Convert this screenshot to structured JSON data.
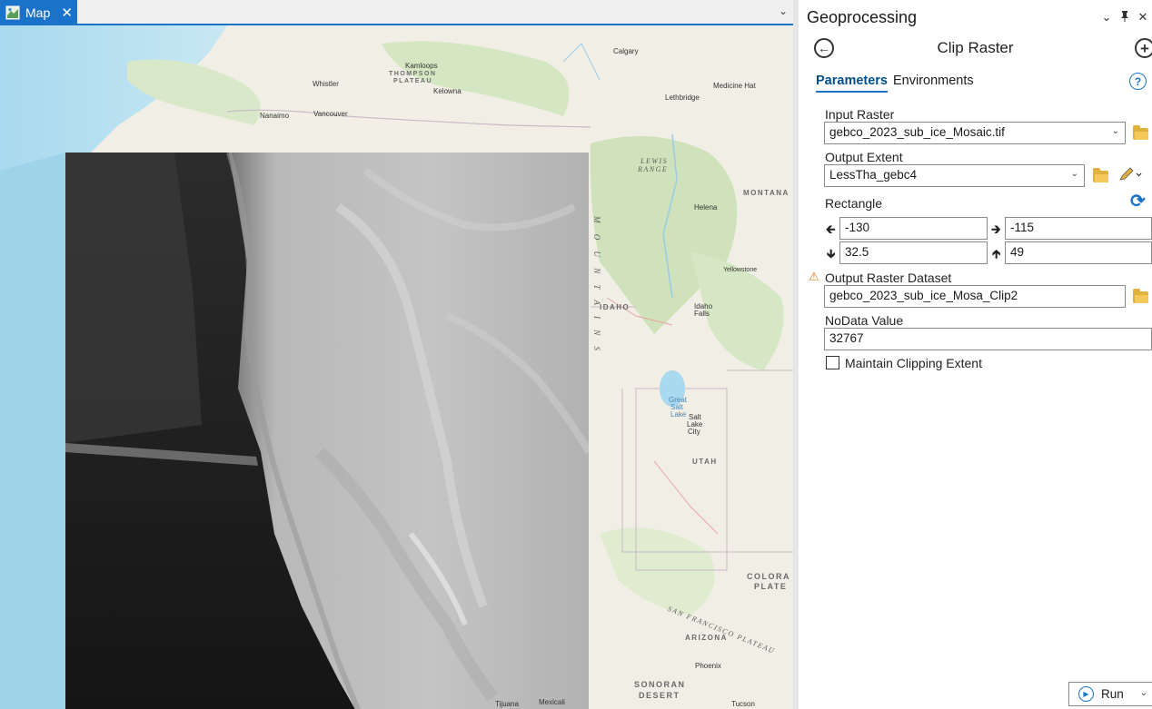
{
  "map_tab": {
    "label": "Map",
    "close": "✕",
    "overflow": "⌄"
  },
  "map_labels": {
    "calgary": "Calgary",
    "kamloops": "Kamloops",
    "thompson": "THOMPSON",
    "plateau": "PLATEAU",
    "whistler": "Whistler",
    "kelowna": "Kelowna",
    "nanaimo": "Nanaimo",
    "vancouver": "Vancouver",
    "medicine_hat": "Medicine Hat",
    "lethbridge": "Lethbridge",
    "lewis": "LEWIS",
    "range": "RANGE",
    "montana": "MONTANA",
    "helena": "Helena",
    "idaho": "IDAHO",
    "idaho_falls_1": "Idaho",
    "idaho_falls_2": "Falls",
    "great_salt_1": "Great",
    "great_salt_2": "Salt",
    "great_salt_3": "Lake",
    "slc_1": "Salt",
    "slc_2": "Lake",
    "slc_3": "City",
    "utah": "UTAH",
    "colorado_1": "COLORA",
    "colorado_2": "PLATE",
    "sf_plateau": "SAN FRANCISCO PLATEAU",
    "arizona": "ARIZONA",
    "phoenix": "Phoenix",
    "sonoran_1": "SONORAN",
    "sonoran_2": "DESERT",
    "tijuana": "Tijuana",
    "mexicali": "Mexicali",
    "tucson": "Tucson",
    "rocky_m": "M O U N T A I N S",
    "yellowstone": "Yellowstone"
  },
  "gp": {
    "title": "Geoprocessing",
    "header_buttons": {
      "menu": "⌄",
      "pin": "📌",
      "close": "✕"
    },
    "back": "←",
    "add": "+",
    "tool_title": "Clip Raster",
    "tabs": [
      "Parameters",
      "Environments"
    ],
    "help": "?",
    "input_raster": {
      "label": "Input Raster",
      "value": "gebco_2023_sub_ice_Mosaic.tif"
    },
    "output_extent": {
      "label": "Output Extent",
      "value": "LessTha_gebc4"
    },
    "rectangle": {
      "label": "Rectangle",
      "left": "-130",
      "right": "-115",
      "bottom": "32.5",
      "top": "49"
    },
    "output_dataset": {
      "label": "Output Raster Dataset",
      "value": "gebco_2023_sub_ice_Mosa_Clip2"
    },
    "nodata": {
      "label": "NoData Value",
      "value": "32767"
    },
    "maintain_extent": {
      "label": "Maintain Clipping Extent",
      "checked": false
    },
    "run": "Run"
  },
  "colors": {
    "accent": "#1a73c8",
    "warning": "#e07a10",
    "folder": "#e0b23b"
  }
}
